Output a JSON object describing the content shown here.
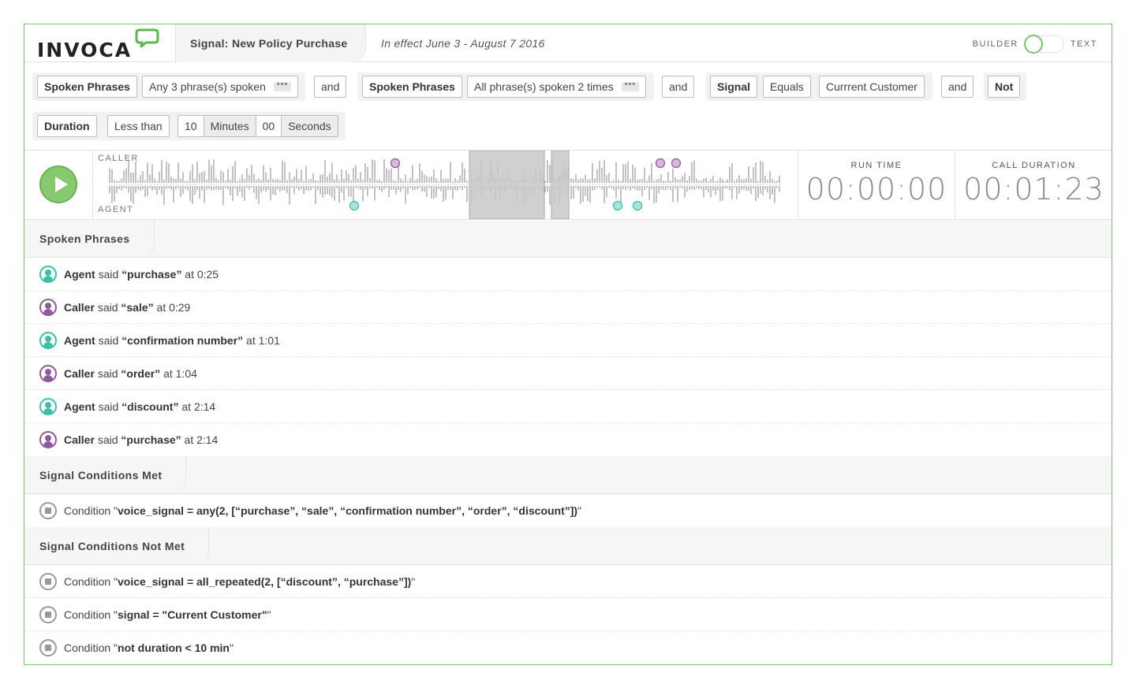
{
  "header": {
    "logo_text": "INVOCA",
    "signal_title": "Signal: New Policy Purchase",
    "effect_text": "In effect June 3 - August 7 2016",
    "mode_left": "BUILDER",
    "mode_right": "TEXT",
    "mode_selected": "BUILDER"
  },
  "builder": {
    "rows": [
      {
        "group1": {
          "type": "Spoken Phrases",
          "value": "Any 3 phrase(s) spoken",
          "more": "•••"
        },
        "op1": "and",
        "group2": {
          "type": "Spoken Phrases",
          "value": "All phrase(s) spoken 2 times",
          "more": "•••"
        },
        "op2": "and",
        "group3": {
          "type": "Signal",
          "comparator": "Equals",
          "value": "Currrent Customer"
        },
        "op3": "and",
        "group4": {
          "type": "Not"
        }
      },
      {
        "group1": {
          "type": "Duration",
          "comparator": "Less than",
          "minutes": "10",
          "minutes_label": "Minutes",
          "seconds": "00",
          "seconds_label": "Seconds"
        }
      }
    ]
  },
  "player": {
    "caller_label": "CALLER",
    "agent_label": "AGENT",
    "run_time_label": "RUN TIME",
    "run_time": "00:00:00",
    "call_duration_label": "CALL DURATION",
    "call_duration": "00:01:23",
    "colors": {
      "agent": "#3cbfa8",
      "caller": "#8e5a9a",
      "play": "#86c96f"
    }
  },
  "spoken_phrases": {
    "title": "Spoken Phrases",
    "items": [
      {
        "speaker": "Agent",
        "said": "said",
        "phrase": "“purchase”",
        "at": "at 0:25",
        "role": "agent"
      },
      {
        "speaker": "Caller",
        "said": "said",
        "phrase": "“sale”",
        "at": "at 0:29",
        "role": "caller"
      },
      {
        "speaker": "Agent",
        "said": "said",
        "phrase": "“confirmation number”",
        "at": "at 1:01",
        "role": "agent"
      },
      {
        "speaker": "Caller",
        "said": "said",
        "phrase": "“order”",
        "at": "at 1:04",
        "role": "caller"
      },
      {
        "speaker": "Agent",
        "said": "said",
        "phrase": "“discount”",
        "at": "at 2:14",
        "role": "agent"
      },
      {
        "speaker": "Caller",
        "said": "said",
        "phrase": "“purchase”",
        "at": "at 2:14",
        "role": "caller"
      }
    ]
  },
  "conditions_met": {
    "title": "Signal Conditions Met",
    "items": [
      {
        "prefix": "Condition \"",
        "expr": "voice_signal = any(2, [“purchase”, “sale”, “confirmation number”, “order”, “discount”])",
        "suffix": "\""
      }
    ]
  },
  "conditions_not_met": {
    "title": "Signal Conditions Not Met",
    "items": [
      {
        "prefix": "Condition \"",
        "expr": "voice_signal = all_repeated(2, [“discount”, “purchase”])",
        "suffix": "\""
      },
      {
        "prefix": "Condition \"",
        "expr": "signal = \"Current Customer\"",
        "suffix": "\""
      },
      {
        "prefix": "Condition \"",
        "expr": "not duration < 10 min",
        "suffix": "\""
      }
    ]
  }
}
